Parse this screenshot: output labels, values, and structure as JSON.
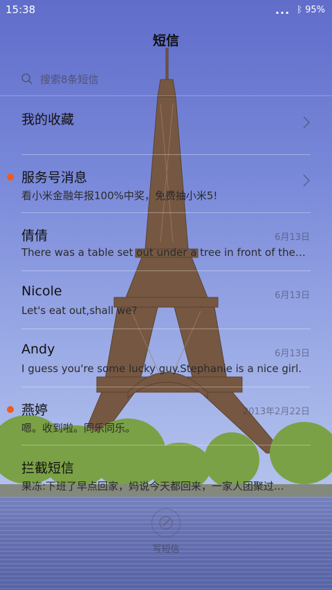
{
  "status_bar": {
    "time": "15:38",
    "dots": "...",
    "battery": "95%"
  },
  "header": {
    "title": "短信"
  },
  "search": {
    "placeholder": "搜索8条短信"
  },
  "list": [
    {
      "name": "我的收藏",
      "snippet": "",
      "date": "",
      "unread": false,
      "chevron": true
    },
    {
      "name": "服务号消息",
      "snippet": "看小米金融年报100%中奖，免费抽小米5!",
      "date": "",
      "unread": true,
      "chevron": true
    },
    {
      "name": "倩倩",
      "snippet": "There was a table set out under a tree in front of the house...",
      "date": "6月13日",
      "unread": false,
      "chevron": false
    },
    {
      "name": "Nicole",
      "snippet": "Let's eat out,shall we?",
      "date": "6月13日",
      "unread": false,
      "chevron": false
    },
    {
      "name": "Andy",
      "snippet": "I guess you're some lucky guy.Stephanie is a nice girl.",
      "date": "6月13日",
      "unread": false,
      "chevron": false
    },
    {
      "name": "燕婷",
      "snippet": "嗯。收到啦。同乐同乐。",
      "date": "2013年2月22日",
      "unread": true,
      "chevron": false
    },
    {
      "name": "拦截短信",
      "snippet": "果冻:下班了早点回家，妈说今天都回来，一家人团聚过...",
      "date": "",
      "unread": false,
      "chevron": false
    }
  ],
  "compose": {
    "label": "写短信"
  },
  "colors": {
    "unread_dot": "#f05a1e",
    "sky_top": "#5361c6",
    "sky_bottom": "#b9c8ef"
  }
}
